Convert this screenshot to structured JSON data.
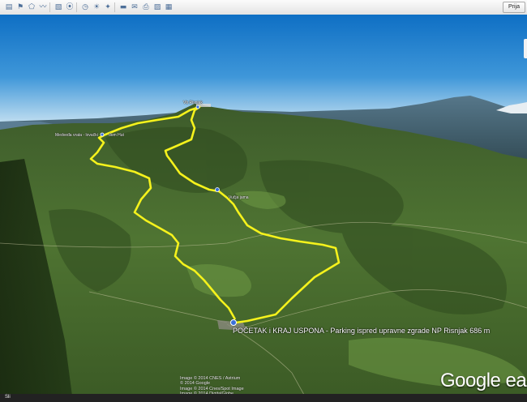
{
  "colors": {
    "route": "#f5f21c",
    "sky_top": "#0e6fc4",
    "sky_horizon": "#cfe6f3"
  },
  "toolbar": {
    "buttons": [
      {
        "icon": "sidebar-toggle-icon",
        "glyph": "▤"
      },
      {
        "icon": "add-placemark-icon",
        "glyph": "⚑"
      },
      {
        "icon": "add-polygon-icon",
        "glyph": "⬠"
      },
      {
        "icon": "add-path-icon",
        "glyph": "〰"
      },
      {
        "icon": "image-overlay-icon",
        "glyph": "▧"
      },
      {
        "icon": "record-tour-icon",
        "glyph": "⦿"
      },
      {
        "icon": "historical-imagery-icon",
        "glyph": "◷"
      },
      {
        "icon": "sunlight-icon",
        "glyph": "☀"
      },
      {
        "icon": "switch-to-sky-icon",
        "glyph": "✦"
      },
      {
        "icon": "ruler-icon",
        "glyph": "▬"
      },
      {
        "icon": "email-icon",
        "glyph": "✉"
      },
      {
        "icon": "print-icon",
        "glyph": "⎙"
      },
      {
        "icon": "save-image-icon",
        "glyph": "▨"
      },
      {
        "icon": "view-in-maps-icon",
        "glyph": "▦"
      }
    ],
    "signin_label": "Prija"
  },
  "map": {
    "start_label": "POČETAK i KRAJ USPONA - Parking  ispred upravne zgrade NP Risnjak 686 m",
    "labels": {
      "summit": "Vb Risnjak",
      "left_top": "Medveđa vrata - lovački",
      "left_top_b": "dom Hut",
      "mid": "Vučja jama"
    },
    "credits": [
      "Image © 2014 CNES / Astrium",
      "© 2014 Google",
      "Image © 2014 Cnes/Spot Image",
      "Image © 2014 DigitalGlobe"
    ],
    "brand": "Google earth",
    "status": "Sli"
  }
}
